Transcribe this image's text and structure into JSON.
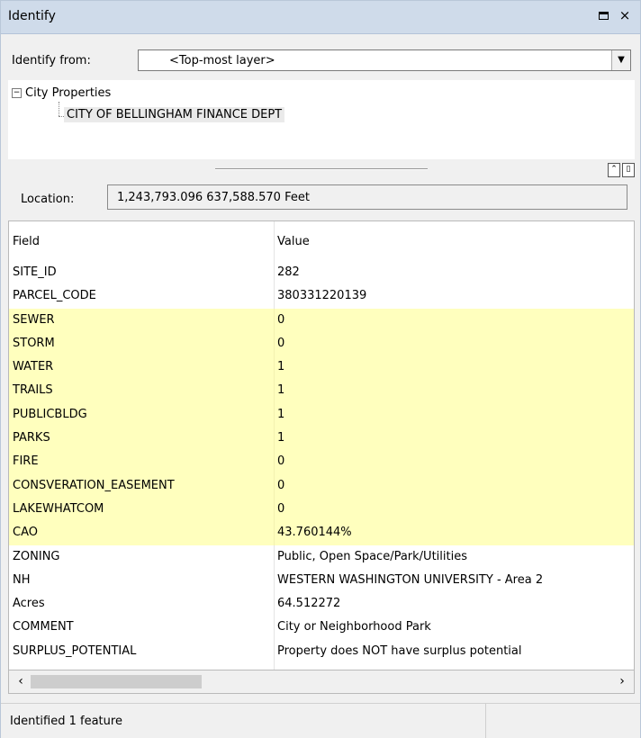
{
  "window": {
    "title": "Identify",
    "restore_icon": "restore-icon",
    "close_glyph": "×"
  },
  "identify_from": {
    "label": "Identify from:",
    "value": "<Top-most layer>",
    "arrow_glyph": "▼"
  },
  "tree": {
    "root_label": "City Properties",
    "expand_glyph": "−",
    "child_label": "CITY OF BELLINGHAM FINANCE DEPT"
  },
  "splitter": {
    "buttons": [
      "⌃",
      "▯"
    ]
  },
  "location": {
    "label": "Location:",
    "value": "1,243,793.096  637,588.570 Feet"
  },
  "grid": {
    "headers": {
      "field": "Field",
      "value": "Value"
    },
    "rows": [
      {
        "field": "SITE_ID",
        "value": "282"
      },
      {
        "field": "PARCEL_CODE",
        "value": "380331220139"
      },
      {
        "field": "SEWER",
        "value": "0"
      },
      {
        "field": "STORM",
        "value": "0"
      },
      {
        "field": "WATER",
        "value": "1"
      },
      {
        "field": "TRAILS",
        "value": "1"
      },
      {
        "field": "PUBLICBLDG",
        "value": "1"
      },
      {
        "field": "PARKS",
        "value": "1"
      },
      {
        "field": "FIRE",
        "value": "0"
      },
      {
        "field": "CONSVERATION_EASEMENT",
        "value": "0"
      },
      {
        "field": "LAKEWHATCOM",
        "value": "0"
      },
      {
        "field": "CAO",
        "value": "43.760144%"
      },
      {
        "field": "ZONING",
        "value": "Public, Open Space/Park/Utilities"
      },
      {
        "field": "NH",
        "value": "WESTERN WASHINGTON UNIVERSITY - Area 2"
      },
      {
        "field": "Acres",
        "value": "64.512272"
      },
      {
        "field": "COMMENT",
        "value": "City or Neighborhood Park"
      },
      {
        "field": "SURPLUS_POTENTIAL",
        "value": "Property does NOT have surplus potential"
      }
    ],
    "highlight_color": "#ffffbe"
  },
  "scrollbar": {
    "left_glyph": "‹",
    "right_glyph": "›"
  },
  "status": {
    "text": "Identified 1 feature"
  }
}
